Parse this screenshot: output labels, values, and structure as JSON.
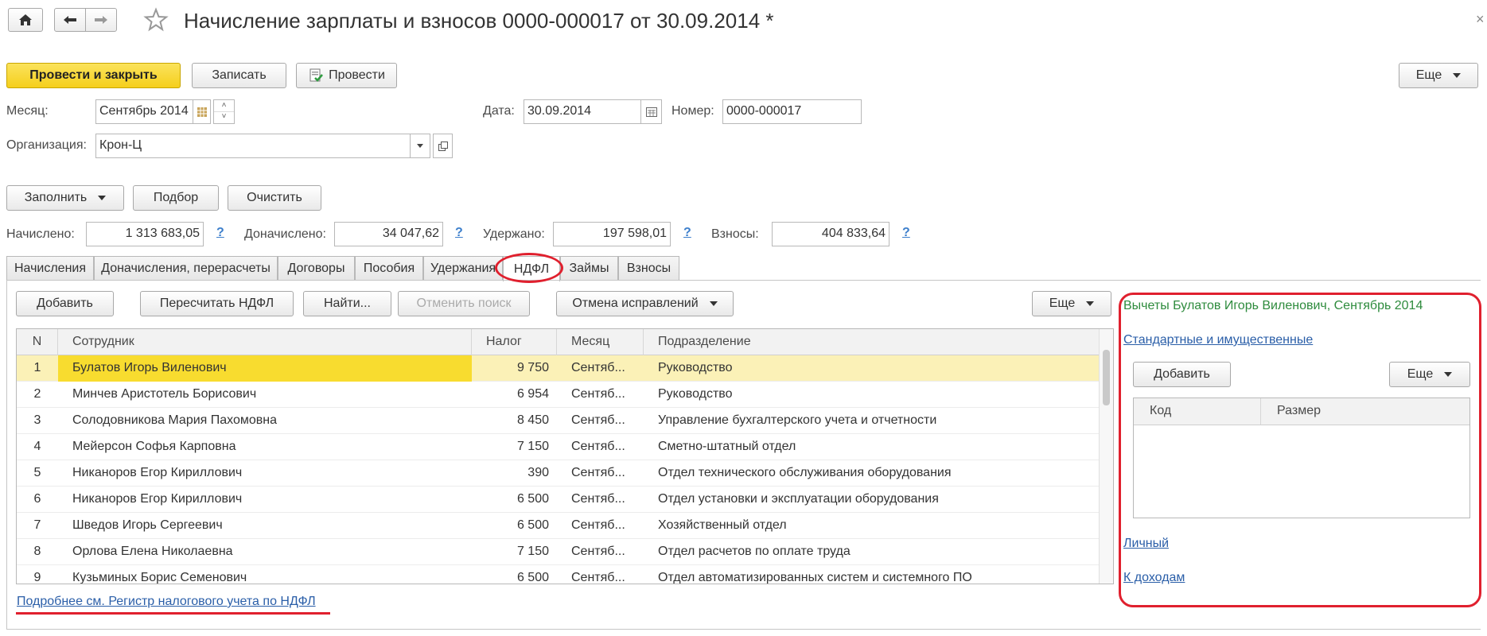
{
  "window": {
    "title": "Начисление зарплаты и взносов 0000-000017 от 30.09.2014 *"
  },
  "toolbar": {
    "post_close": "Провести и закрыть",
    "save": "Записать",
    "post": "Провести",
    "more": "Еще"
  },
  "form": {
    "month_label": "Месяц:",
    "month_value": "Сентябрь 2014",
    "date_label": "Дата:",
    "date_value": "30.09.2014",
    "number_label": "Номер:",
    "number_value": "0000-000017",
    "org_label": "Организация:",
    "org_value": "Крон-Ц"
  },
  "actions": {
    "fill": "Заполнить",
    "select": "Подбор",
    "clear": "Очистить"
  },
  "totals": {
    "accrued_label": "Начислено:",
    "accrued_value": "1 313 683,05",
    "extra_label": "Доначислено:",
    "extra_value": "34 047,62",
    "withheld_label": "Удержано:",
    "withheld_value": "197 598,01",
    "contrib_label": "Взносы:",
    "contrib_value": "404 833,64",
    "help": "?"
  },
  "tabs": [
    {
      "label": "Начисления"
    },
    {
      "label": "Доначисления, перерасчеты"
    },
    {
      "label": "Договоры"
    },
    {
      "label": "Пособия"
    },
    {
      "label": "Удержания"
    },
    {
      "label": "НДФЛ",
      "active": true
    },
    {
      "label": "Займы"
    },
    {
      "label": "Взносы"
    }
  ],
  "ndfl_toolbar": {
    "add": "Добавить",
    "recalc": "Пересчитать НДФЛ",
    "find": "Найти...",
    "cancel_search": "Отменить поиск",
    "cancel_fix": "Отмена исправлений",
    "more": "Еще"
  },
  "table": {
    "columns": [
      "N",
      "Сотрудник",
      "Налог",
      "Месяц",
      "Подразделение"
    ],
    "rows": [
      {
        "n": "1",
        "employee": "Булатов Игорь Виленович",
        "tax": "9 750",
        "month": "Сентяб...",
        "dept": "Руководство"
      },
      {
        "n": "2",
        "employee": "Минчев Аристотель Борисович",
        "tax": "6 954",
        "month": "Сентяб...",
        "dept": "Руководство"
      },
      {
        "n": "3",
        "employee": "Солодовникова Мария Пахомовна",
        "tax": "8 450",
        "month": "Сентяб...",
        "dept": "Управление бухгалтерского учета и отчетности"
      },
      {
        "n": "4",
        "employee": "Мейерсон Софья Карповна",
        "tax": "7 150",
        "month": "Сентяб...",
        "dept": "Сметно-штатный отдел"
      },
      {
        "n": "5",
        "employee": "Никаноров Егор Кириллович",
        "tax": "390",
        "month": "Сентяб...",
        "dept": "Отдел технического обслуживания оборудования"
      },
      {
        "n": "6",
        "employee": "Никаноров Егор Кириллович",
        "tax": "6 500",
        "month": "Сентяб...",
        "dept": "Отдел установки и эксплуатации оборудования"
      },
      {
        "n": "7",
        "employee": "Шведов Игорь Сергеевич",
        "tax": "6 500",
        "month": "Сентяб...",
        "dept": "Хозяйственный отдел"
      },
      {
        "n": "8",
        "employee": "Орлова Елена Николаевна",
        "tax": "7 150",
        "month": "Сентяб...",
        "dept": "Отдел расчетов по оплате труда"
      },
      {
        "n": "9",
        "employee": "Кузьминых Борис Семенович",
        "tax": "6 500",
        "month": "Сентяб...",
        "dept": "Отдел автоматизированных систем и системного ПО"
      }
    ]
  },
  "register_link": "Подробнее см. Регистр налогового учета по НДФЛ",
  "deductions": {
    "title": "Вычеты Булатов Игорь Виленович, Сентябрь 2014",
    "standard_link": "Стандартные и имущественные",
    "add": "Добавить",
    "more": "Еще",
    "columns": [
      "Код",
      "Размер"
    ],
    "personal_link": "Личный",
    "to_income_link": "К доходам"
  },
  "colors": {
    "primary_button": "#f5cf1c",
    "selected_row": "#fbf1b7",
    "selected_cell": "#f8dc2f",
    "annotation": "#e0202e",
    "green_title": "#2e8b3d",
    "link": "#2a5ea8"
  }
}
